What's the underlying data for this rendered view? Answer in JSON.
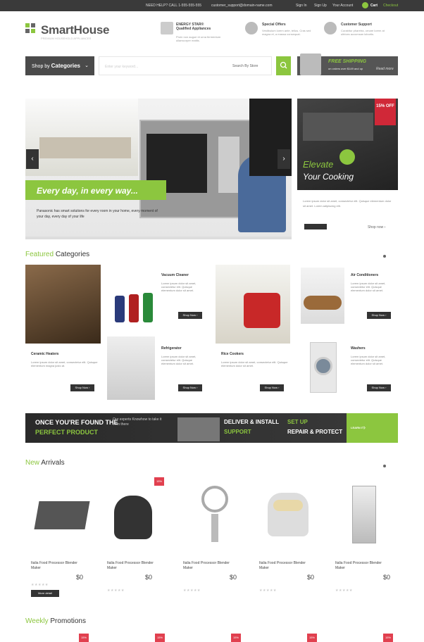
{
  "topbar": {
    "need_help": "NEED HELP? CALL 1-555-555-555",
    "email": "customer_support@domain-name.com",
    "links": [
      "Sign In",
      "Sign Up",
      "Your Account"
    ],
    "cart": "Cart",
    "checkout": "Checkout"
  },
  "logo": {
    "name": "SmartHouse",
    "tagline": "PREMIUM HOUSEHOLD APPLIANCES"
  },
  "features": [
    {
      "icon": "energy-star-icon",
      "title": "ENERGY STAR® Qualified Appliances",
      "desc": "Proin non augue et urna fermentum ullamcorper mattis."
    },
    {
      "icon": "dollar-icon",
      "title": "Special Offers",
      "desc": "Vestibulum lorem ante, tellus. Cras sed magna et, a massa consequat."
    },
    {
      "icon": "phone-icon",
      "title": "Customer Support",
      "desc": "Curabitur pharetra, ornare lorem at ultrices accumsan lobortis."
    }
  ],
  "search": {
    "category_btn_prefix": "Shop by",
    "category_btn": "Categories",
    "placeholder": "Enter your keyword...",
    "select": "Search By Store",
    "free_title": "FREE SHIPPING",
    "free_sub": "on orders over $149 and up",
    "free_link": "Read more"
  },
  "hero": {
    "headline": "Every day, in every way...",
    "desc": "Panasonic has smart solutions for every room in your home, every moment of your day, every day of your life",
    "side_title_1": "Elevate",
    "side_title_2": "Your Cooking",
    "side_badge": "15% OFF",
    "side_desc": "Lorem ipsum dolor sit amet, consectetur elit. Quisque elementum dolor sit amet. Lorem adipiscing elit.",
    "side_link": "Shop now ›"
  },
  "featured": {
    "heading_1": "Featured",
    "heading_2": "Categories",
    "items": [
      {
        "title": "Ceramic Heaters",
        "desc": "Lorem ipsum dolor sit amet, consectetur elit. Quisque elementum magna justo at.",
        "btn": "Shop Now ›"
      },
      {
        "title": "Vacuum Cleaner",
        "desc": "Lorem ipsum dolor sit amet, consectetur elit. Quisque elementum dolor sit amet.",
        "btn": "Shop Now ›"
      },
      {
        "title": "Refrigerator",
        "desc": "Lorem ipsum dolor sit amet, consectetur elit. Quisque elementum dolor sit amet.",
        "btn": "Shop Now ›"
      },
      {
        "title": "Rice Cookers",
        "desc": "Lorem ipsum dolor sit amet, consectetur elit. Quisque elementum dolor sit amet.",
        "btn": "Shop Now ›"
      },
      {
        "title": "Air Conditioners",
        "desc": "Lorem ipsum dolor sit amet, consectetur elit. Quisque elementum dolor sit amet.",
        "btn": "Shop Now ›"
      },
      {
        "title": "Washers",
        "desc": "Lorem ipsum dolor sit amet, consectetur elit. Quisque elementum dolor sit amet.",
        "btn": "Shop Now ›"
      }
    ]
  },
  "banner": {
    "a1": "ONCE YOU'RE FOUND THE",
    "a2": "PERFECT PRODUCT",
    "mid": "Our experts Knowhow to take it from there",
    "b1": "DELIVER & INSTALL",
    "b2": "SUPPORT",
    "c1": "SET UP",
    "c2": "REPAIR & PROTECT",
    "btn": "LEARN IT"
  },
  "arrivals": {
    "heading_1": "New",
    "heading_2": "Arrivals",
    "products": [
      {
        "name": "Italia Food Processor Blender Maker",
        "price": "$0",
        "btn": "More detail"
      },
      {
        "name": "Italia Food Processor Blender Maker",
        "price": "$0",
        "badge": "15%"
      },
      {
        "name": "Italia Food Processor Blender Maker",
        "price": "$0"
      },
      {
        "name": "Italia Food Processor Blender Maker",
        "price": "$0"
      },
      {
        "name": "Italia Food Processor Blender Maker",
        "price": "$0"
      }
    ]
  },
  "weekly": {
    "heading_1": "Weekly",
    "heading_2": "Promotions",
    "badges": [
      "15%",
      "15%",
      "15%",
      "15%",
      "15%"
    ]
  },
  "colors": {
    "accent": "#8cc63f",
    "dark": "#333333",
    "sale": "#e1404f"
  }
}
